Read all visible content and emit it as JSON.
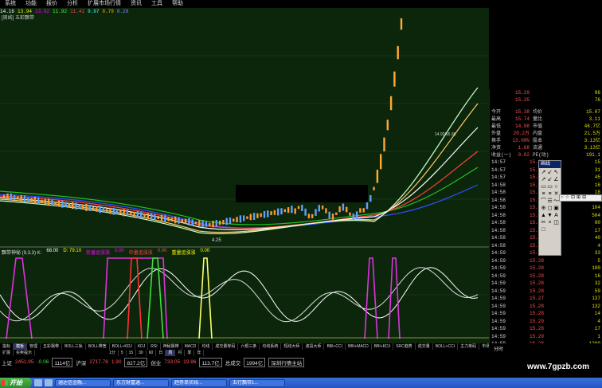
{
  "menu": [
    "系统",
    "功能",
    "报价",
    "分析",
    "扩展市场行情",
    "资讯",
    "工具",
    "帮助"
  ],
  "chart": {
    "info_values": [
      "14.16",
      "13.94",
      "13.62",
      "11.92",
      "11.41",
      "9.97",
      "8.79",
      "8.29"
    ],
    "title": "[周线] 五彩飘带",
    "low_label": "4.25",
    "mid_label": "14.92/15.36",
    "indicator_name": "飘带神秘 (9,3,3) K:",
    "indicator_k": "68.00",
    "indicator_d": "D: 79.10",
    "indicator_extra": [
      "轮番追涨涨",
      "中量追涨涨",
      "重量追涨涨"
    ],
    "indicator_extra_val": [
      "0.00",
      "0.00",
      "0.00"
    ]
  },
  "quote": {
    "head": [
      {
        "label": "",
        "val": "15.29",
        "label2": "",
        "val2": "86"
      },
      {
        "label": "",
        "val": "15.25",
        "label2": "",
        "val2": "76"
      }
    ],
    "rows": [
      {
        "label": "今开",
        "val": "15.38",
        "label2": "均价",
        "val2": "15.07"
      },
      {
        "label": "最高",
        "val": "15.74",
        "label2": "量比",
        "val2": "3.11"
      },
      {
        "label": "最低",
        "val": "14.98",
        "label2": "市值",
        "val2": "46.7亿"
      },
      {
        "label": "外盘",
        "val": "20.2万",
        "label2": "内盘",
        "val2": "21.5万"
      },
      {
        "label": "换手",
        "val": "13.09%",
        "label2": "股本",
        "val2": "3.13亿"
      },
      {
        "label": "净资",
        "val": "1.68",
        "label2": "流通",
        "val2": "3.13亿"
      },
      {
        "label": "收益(一)",
        "val": "0.02",
        "label2": "PE(动)",
        "val2": "191.1"
      }
    ]
  },
  "ticks": [
    {
      "time": "14:57",
      "price": "15.28",
      "vol": "15"
    },
    {
      "time": "14:57",
      "price": "15.29",
      "vol": "31"
    },
    {
      "time": "14:57",
      "price": "15.28",
      "vol": "45"
    },
    {
      "time": "14:58",
      "price": "15.28",
      "vol": "16"
    },
    {
      "time": "14:58",
      "price": "15.28",
      "vol": "18"
    },
    {
      "time": "14:58",
      "price": "15.29",
      "vol": "3"
    },
    {
      "time": "14:58",
      "price": "15.28",
      "vol": "104"
    },
    {
      "time": "14:58",
      "price": "15.28",
      "vol": "504"
    },
    {
      "time": "14:58",
      "price": "15.28",
      "vol": "80"
    },
    {
      "time": "14:58",
      "price": "15.29",
      "vol": "17"
    },
    {
      "time": "14:58",
      "price": "15.28",
      "vol": "40"
    },
    {
      "time": "14:58",
      "price": "15.28",
      "vol": "4"
    },
    {
      "time": "14:59",
      "price": "15.28",
      "vol": "33"
    },
    {
      "time": "14:59",
      "price": "15.28",
      "vol": "5"
    },
    {
      "time": "14:59",
      "price": "15.28",
      "vol": "100"
    },
    {
      "time": "14:59",
      "price": "15.28",
      "vol": "16"
    },
    {
      "time": "14:59",
      "price": "15.28",
      "vol": "32"
    },
    {
      "time": "14:59",
      "price": "15.28",
      "vol": "59"
    },
    {
      "time": "14:59",
      "price": "15.27",
      "vol": "137"
    },
    {
      "time": "14:59",
      "price": "15.28",
      "vol": "132"
    },
    {
      "time": "14:59",
      "price": "15.28",
      "vol": "14"
    },
    {
      "time": "14:59",
      "price": "15.29",
      "vol": "4"
    },
    {
      "time": "14:59",
      "price": "15.28",
      "vol": "17"
    },
    {
      "time": "14:59",
      "price": "15.29",
      "vol": "1"
    },
    {
      "time": "14:59",
      "price": "15.28",
      "vol": "1200"
    },
    {
      "time": "15:00",
      "price": "15.28",
      "vol": "5"
    }
  ],
  "toolbox": {
    "title": "画线",
    "tools": [
      "↗",
      "↙",
      "↖",
      "↗",
      "↙",
      "∠",
      "▭",
      "▭",
      "○",
      "≡",
      "≡",
      "✕",
      "⌒",
      "☰",
      "〜",
      "⊕",
      "◻",
      "▣",
      "▲",
      "▼",
      "A",
      "✂",
      "×",
      "◫",
      "□",
      "",
      ""
    ]
  },
  "mini_toolbar": [
    "○",
    "☆",
    "⊡",
    "⊞",
    "⊟"
  ],
  "tabs_row1": [
    "指标",
    "模板",
    "管理",
    "五彩飘带",
    "BOLL三轨",
    "BOLL带宽",
    "BOLL+KDJ",
    "KDJ",
    "RSI",
    "神秘飘带",
    "MACD",
    "均线",
    "成交量筹码",
    "六根三条",
    "均线系统",
    "短线大师",
    "波段大师",
    "BBI+CCI",
    "BBI+MACD",
    "BBI+KDJ",
    "SRC趋势",
    "成交量",
    "BOLL+CCI",
    "主力筹码",
    "市场三线",
    "主力建仓",
    "BOLL"
  ],
  "tabs_row2": [
    "扩展",
    "买卖提示"
  ],
  "period_tabs": [
    "1分",
    "5",
    "15",
    "30",
    "60",
    "日",
    "周",
    "月",
    "季",
    "年"
  ],
  "right_tabs": "分时",
  "status": {
    "sh_label": "上证",
    "sh_val": "2451.95",
    "sh_chg": "-0.06",
    "sh_amt": "1114亿",
    "sz_label": "沪深",
    "sz_val": "2717.78",
    "sz_chg": "1.90",
    "sz_amt": "827.2亿",
    "cy_label": "创业",
    "cy_val": "733.05",
    "cy_chg": "19.86",
    "cy_amt": "113.7亿",
    "total_label": "总成交",
    "total_val": "1994亿",
    "conn": "深圳行情主站"
  },
  "logo": "www.7gpzb.com",
  "taskbar": {
    "start": "开始",
    "tasks": [
      "通达信金融...",
      "东方财富通...",
      "趋势单买线...",
      "五行飘带1..."
    ]
  },
  "colors": {
    "chart_bg": "#0c260c",
    "up": "#ff5050",
    "down": "#40e040",
    "k_line": "#ffffff",
    "d_line": "#ffff66"
  }
}
